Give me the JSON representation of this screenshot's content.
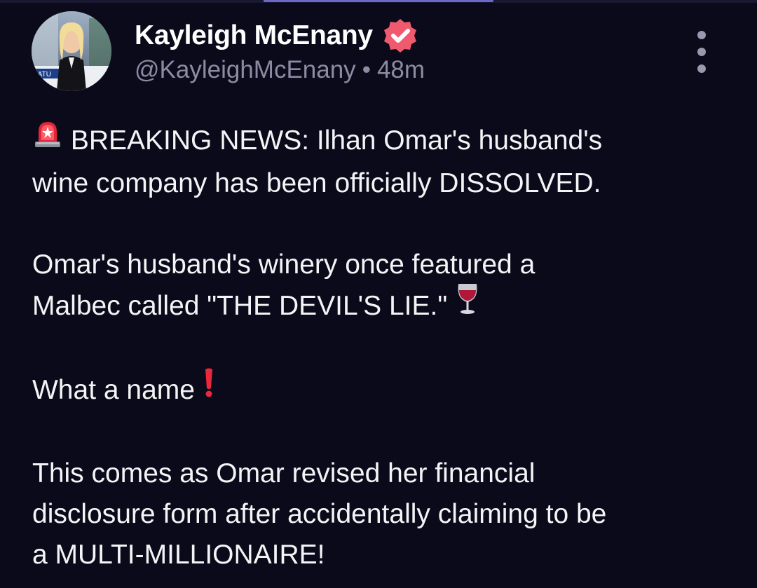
{
  "post": {
    "author": {
      "display_name": "Kayleigh McEnany",
      "handle": "@KayleighMcEnany",
      "verified": true,
      "verified_badge_color": "#f05a6e",
      "avatar_caption": "SATU"
    },
    "time_separator": "•",
    "timestamp": "48m",
    "more_icon": "vertical-ellipsis-icon",
    "paragraphs": [
      {
        "lead_icon": "rotating-light-emoji",
        "lines": [
          "BREAKING NEWS: Ilhan Omar's husband's",
          "wine company has been officially DISSOLVED."
        ]
      },
      {
        "lines": [
          "Omar's husband's winery once featured a",
          "Malbec called \"THE DEVIL'S LIE.\""
        ],
        "trail_icon": "wine-glass-emoji"
      },
      {
        "lines": [
          "What a name"
        ],
        "trail_icon": "exclamation-mark-emoji"
      },
      {
        "lines": [
          "This comes as Omar revised her financial",
          "disclosure form after accidentally claiming to be",
          "a MULTI-MILLIONAIRE!"
        ]
      }
    ]
  },
  "colors": {
    "background": "#0b0a1a",
    "text": "#f4f4f6",
    "meta_text": "#8d8ba3",
    "accent_bar": "#6c68c8"
  }
}
